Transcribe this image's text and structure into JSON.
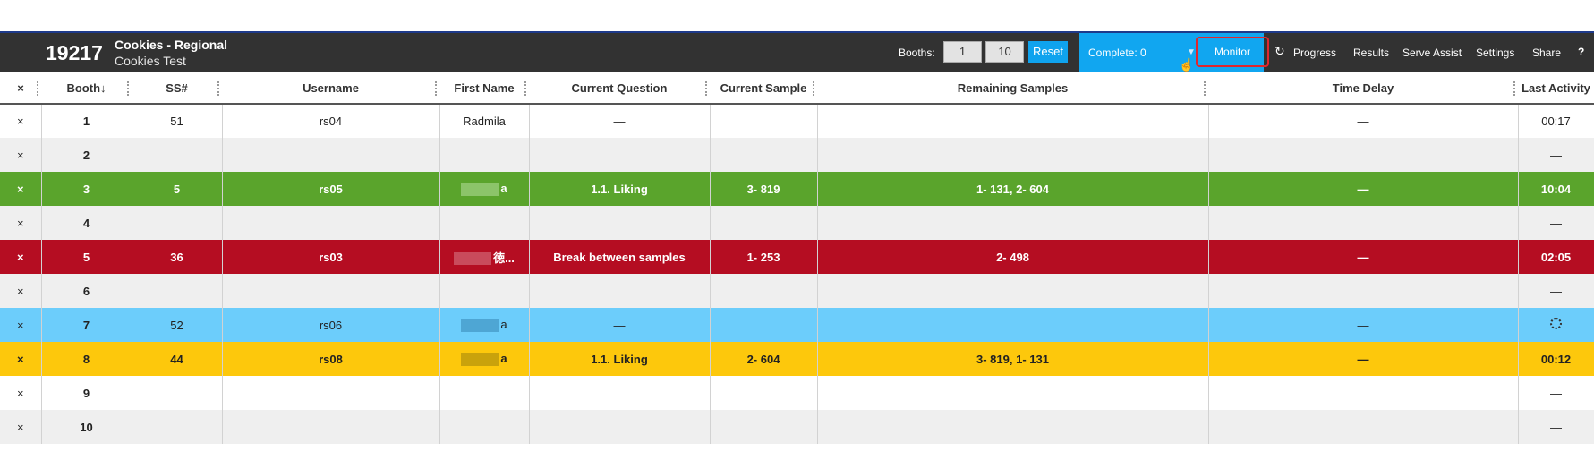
{
  "header": {
    "project_id": "19217",
    "project_title": "Cookies - Regional",
    "project_subtitle": "Cookies Test",
    "booths_label": "Booths:",
    "booth_from": "1",
    "booth_to": "10",
    "reset_label": "Reset",
    "complete_label": "Complete: 0",
    "nav": {
      "monitor": "Monitor",
      "progress": "Progress",
      "results": "Results",
      "serve_assist": "Serve Assist",
      "settings": "Settings",
      "share": "Share"
    },
    "icons": [
      "refresh-icon",
      "help-icon",
      "caret-down-icon",
      "hand-cursor-icon"
    ]
  },
  "table": {
    "columns": [
      "×",
      "Booth↓",
      "SS#",
      "Username",
      "First Name",
      "Current Question",
      "Current Sample",
      "Remaining Samples",
      "Time Delay",
      "Last Activity"
    ],
    "rows": [
      {
        "x": "×",
        "booth": "1",
        "ss": "51",
        "username": "rs04",
        "first_name": "Radmila",
        "question": "—",
        "sample": "",
        "remaining": "",
        "delay": "—",
        "last": "00:17",
        "style": "white"
      },
      {
        "x": "×",
        "booth": "2",
        "ss": "",
        "username": "",
        "first_name": "",
        "question": "",
        "sample": "",
        "remaining": "",
        "delay": "",
        "last": "—",
        "style": "gray"
      },
      {
        "x": "×",
        "booth": "3",
        "ss": "5",
        "username": "rs05",
        "first_name": "a",
        "question": "1.1. Liking",
        "sample": "3- 819",
        "remaining": "1- 131, 2- 604",
        "delay": "—",
        "last": "10:04",
        "style": "green"
      },
      {
        "x": "×",
        "booth": "4",
        "ss": "",
        "username": "",
        "first_name": "",
        "question": "",
        "sample": "",
        "remaining": "",
        "delay": "",
        "last": "—",
        "style": "gray"
      },
      {
        "x": "×",
        "booth": "5",
        "ss": "36",
        "username": "rs03",
        "first_name": "徳...",
        "question": "Break between samples",
        "sample": "1- 253",
        "remaining": "2- 498",
        "delay": "—",
        "last": "02:05",
        "style": "red"
      },
      {
        "x": "×",
        "booth": "6",
        "ss": "",
        "username": "",
        "first_name": "",
        "question": "",
        "sample": "",
        "remaining": "",
        "delay": "",
        "last": "—",
        "style": "gray"
      },
      {
        "x": "×",
        "booth": "7",
        "ss": "52",
        "username": "rs06",
        "first_name": "a",
        "question": "—",
        "sample": "",
        "remaining": "",
        "delay": "—",
        "last": "",
        "style": "blue"
      },
      {
        "x": "×",
        "booth": "8",
        "ss": "44",
        "username": "rs08",
        "first_name": "a",
        "question": "1.1. Liking",
        "sample": "2- 604",
        "remaining": "3- 819, 1- 131",
        "delay": "—",
        "last": "00:12",
        "style": "yellow"
      },
      {
        "x": "×",
        "booth": "9",
        "ss": "",
        "username": "",
        "first_name": "",
        "question": "",
        "sample": "",
        "remaining": "",
        "delay": "",
        "last": "—",
        "style": "white"
      },
      {
        "x": "×",
        "booth": "10",
        "ss": "",
        "username": "",
        "first_name": "",
        "question": "",
        "sample": "",
        "remaining": "",
        "delay": "",
        "last": "—",
        "style": "gray"
      }
    ]
  },
  "colors": {
    "topbar": "#323232",
    "accent_blue": "#11a6f0",
    "reset_blue": "#0fa3ee",
    "monitor_outline": "#e0262e",
    "row_green": "#5aa42c",
    "row_red": "#b50d22",
    "row_blue": "#6ccdfb",
    "row_yellow": "#fdc80c",
    "row_gray": "#efefef"
  }
}
